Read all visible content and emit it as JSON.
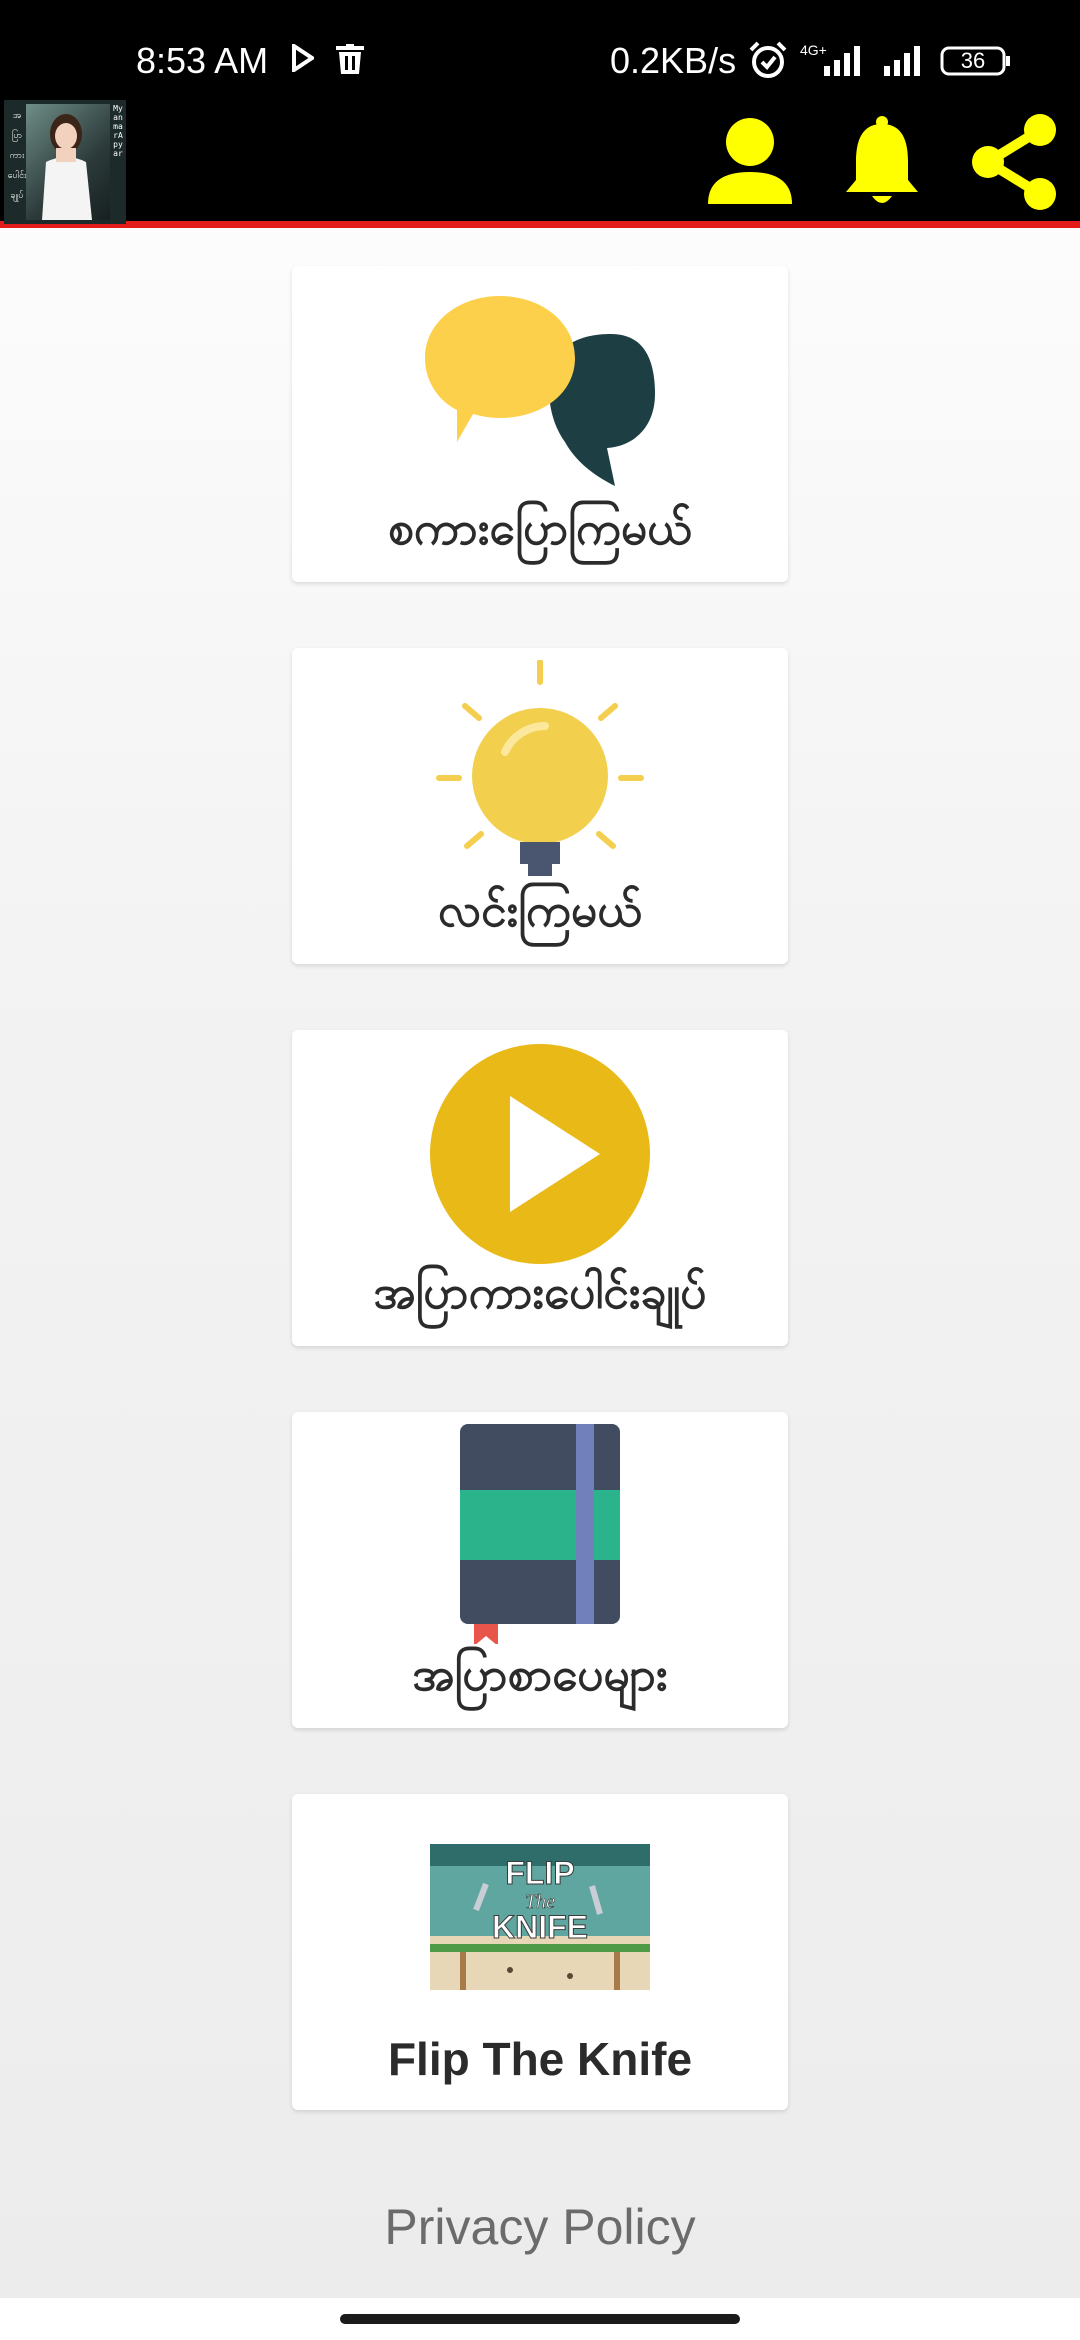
{
  "status_bar": {
    "time": "8:53 AM",
    "network_speed": "0.2KB/s",
    "network_type": "4G+",
    "battery": "36",
    "icons": [
      "play-icon",
      "trash-icon",
      "alarm-icon",
      "signal-icon",
      "signal-icon",
      "battery-icon"
    ]
  },
  "app_bar": {
    "logo_side_text": [
      "အ",
      "ပြာ",
      "ကား",
      "ပေါင်း",
      "ချုပ်"
    ],
    "logo_vertical_text": "MyanmarApyar",
    "actions": [
      "user-icon",
      "bell-icon",
      "share-icon"
    ],
    "accent_color": "#ffff00",
    "divider_color": "#e31b1b"
  },
  "menu": [
    {
      "label": "စကားပြောကြမယ်",
      "icon": "chat-bubbles-icon"
    },
    {
      "label": "လင်းကြမယ်",
      "icon": "lightbulb-icon"
    },
    {
      "label": "အပြာကားပေါင်းချုပ်",
      "icon": "play-icon"
    },
    {
      "label": "အပြာစာပေများ",
      "icon": "book-icon"
    },
    {
      "label": "Flip The Knife",
      "icon": "game-thumbnail",
      "thumbnail_text": [
        "FLIP",
        "The",
        "KNIFE"
      ]
    }
  ],
  "footer": {
    "privacy_label": "Privacy Policy"
  }
}
